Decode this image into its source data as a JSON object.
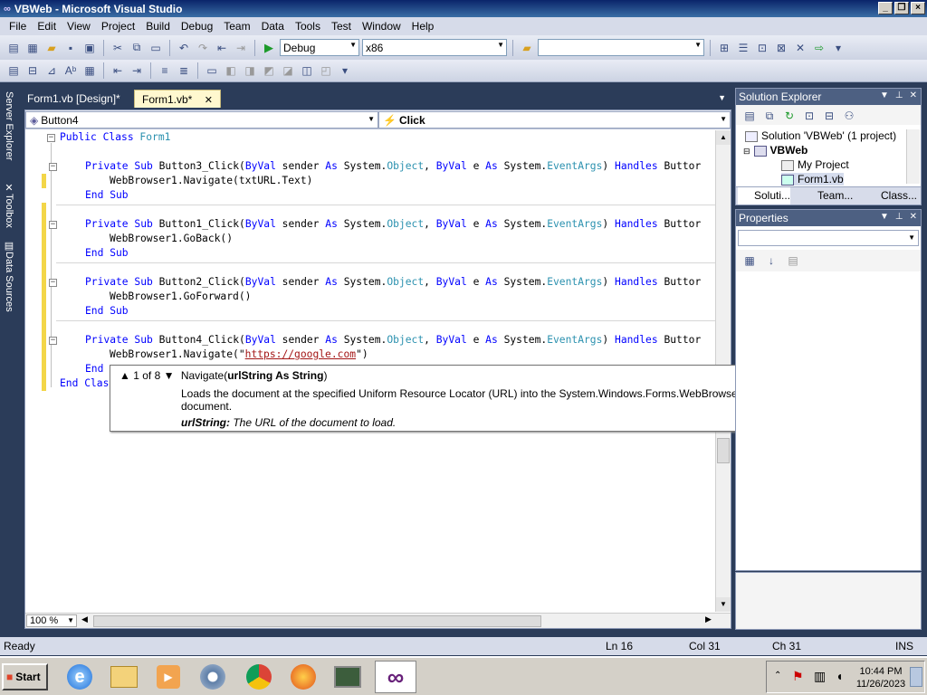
{
  "window": {
    "title": "VBWeb - Microsoft Visual Studio"
  },
  "menu": [
    "File",
    "Edit",
    "View",
    "Project",
    "Build",
    "Debug",
    "Team",
    "Data",
    "Tools",
    "Test",
    "Window",
    "Help"
  ],
  "toolbar": {
    "config": "Debug",
    "platform": "x86",
    "find_value": ""
  },
  "side_tabs": [
    "Server Explorer",
    "Toolbox",
    "Data Sources"
  ],
  "doc_tabs": [
    "Form1.vb [Design]*",
    "Form1.vb*"
  ],
  "editor": {
    "nav_left": "Button4",
    "nav_right": "Click",
    "lines": {
      "l1": [
        "Public Class",
        " Form1"
      ],
      "b3": {
        "kw1": "Private Sub",
        "name": " Button3_Click(",
        "kw2": "ByVal",
        "p1": " sender ",
        "kw3": "As",
        "p2": " System.",
        "ty1": "Object",
        "p3": ", ",
        "kw4": "ByVal",
        "p4": " e ",
        "kw5": "As",
        "p5": " System.",
        "ty2": "EventArgs",
        "p6": ") ",
        "kw6": "Handles",
        "p7": " Buttor"
      },
      "b3_body": "WebBrowser1.Navigate(txtURL.Text)",
      "b1": " Button1_Click(",
      "b1_body": "WebBrowser1.GoBack()",
      "b2": " Button2_Click(",
      "b2_body": "WebBrowser1.GoForward()",
      "b4": " Button4_Click(",
      "b4_body_pre": "WebBrowser1.Navigate(\"",
      "b4_body_str": "https://google.com",
      "b4_body_post": "\")",
      "end_sub": "End Sub",
      "end_partial": "End",
      "end_class_partial": "End Clas"
    },
    "zoom": "100 %"
  },
  "tooltip": {
    "counter": "1 of 8",
    "method": "Navigate(",
    "param_sig": "urlString As String",
    "close_paren": ")",
    "description": "Loads the document at the specified Uniform Resource Locator (URL) into the System.Windows.Forms.WebBrowser control, replacing the previous document.",
    "param_name": "urlString:",
    "param_desc": " The URL of the document to load."
  },
  "solution_explorer": {
    "title": "Solution Explorer",
    "items": [
      "Solution 'VBWeb' (1 project)",
      "VBWeb",
      "My Project",
      "Form1.vb"
    ],
    "tabs": [
      "Soluti...",
      "Team...",
      "Class..."
    ]
  },
  "properties": {
    "title": "Properties"
  },
  "status": {
    "left": "Ready",
    "ln": "Ln 16",
    "col": "Col 31",
    "ch": "Ch 31",
    "mode": "INS"
  },
  "taskbar": {
    "start": "Start",
    "time": "10:44 PM",
    "date": "11/26/2023"
  },
  "colors": {
    "keyword": "#0000ff",
    "type": "#2b91af",
    "string": "#a31515",
    "accent": "#2b3c59"
  }
}
